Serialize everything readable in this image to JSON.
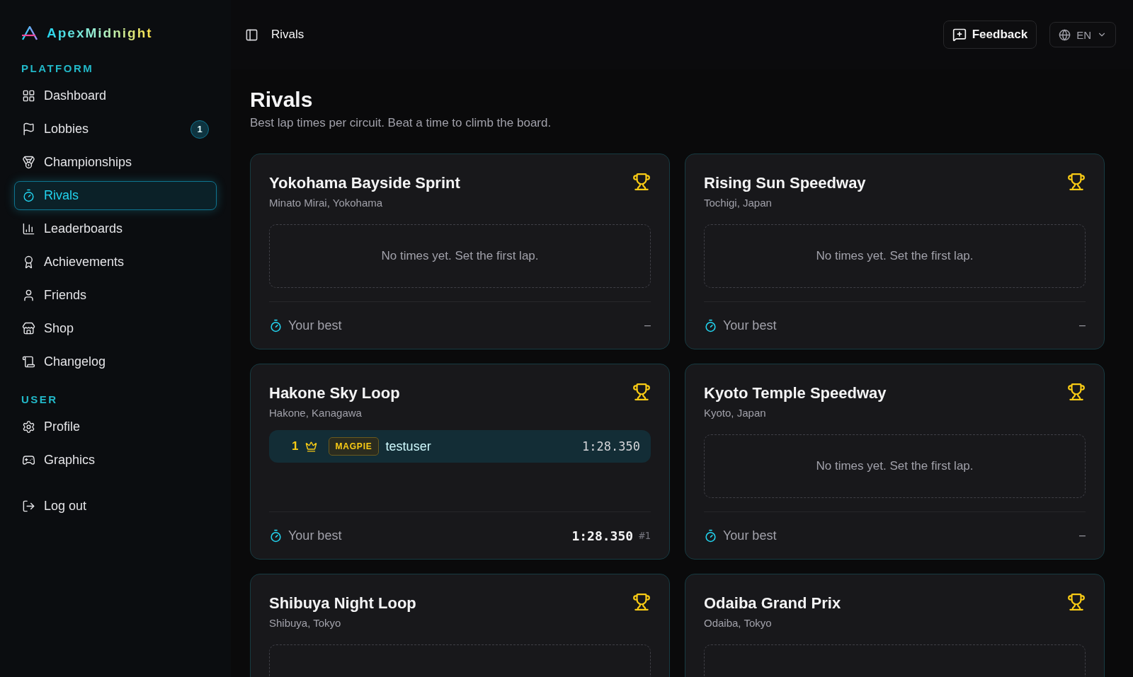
{
  "brand": "ApexMidnight",
  "sidebar": {
    "sections": [
      {
        "title": "PLATFORM",
        "items": [
          {
            "label": "Dashboard",
            "selected": false
          },
          {
            "label": "Lobbies",
            "selected": false,
            "badge": "1"
          },
          {
            "label": "Championships",
            "selected": false
          },
          {
            "label": "Rivals",
            "selected": true
          },
          {
            "label": "Leaderboards",
            "selected": false
          },
          {
            "label": "Achievements",
            "selected": false
          },
          {
            "label": "Friends",
            "selected": false
          },
          {
            "label": "Shop",
            "selected": false
          },
          {
            "label": "Changelog",
            "selected": false
          }
        ]
      },
      {
        "title": "USER",
        "items": [
          {
            "label": "Profile",
            "selected": false
          },
          {
            "label": "Graphics",
            "selected": false
          }
        ]
      }
    ],
    "logout": "Log out"
  },
  "header": {
    "breadcrumb": "Rivals",
    "feedback": "Feedback",
    "language": "EN"
  },
  "page": {
    "title": "Rivals",
    "subtitle": "Best lap times per circuit. Beat a time to climb the board."
  },
  "circuits": [
    {
      "title": "Yokohama Bayside Sprint",
      "location": "Minato Mirai, Yokohama",
      "empty_text": "No times yet. Set the first lap.",
      "best_label": "Your best",
      "best_time": "–"
    },
    {
      "title": "Rising Sun Speedway",
      "location": "Tochigi, Japan",
      "empty_text": "No times yet. Set the first lap.",
      "best_label": "Your best",
      "best_time": "–"
    },
    {
      "title": "Hakone Sky Loop",
      "location": "Hakone, Kanagawa",
      "entries": [
        {
          "rank": "1",
          "tag": "MAGPIE",
          "name": "testuser",
          "time": "1:28.350",
          "mine": true
        }
      ],
      "best_label": "Your best",
      "best_time": "1:28.350",
      "best_rank": "#1"
    },
    {
      "title": "Kyoto Temple Speedway",
      "location": "Kyoto, Japan",
      "empty_text": "No times yet. Set the first lap.",
      "best_label": "Your best",
      "best_time": "–"
    },
    {
      "title": "Shibuya Night Loop",
      "location": "Shibuya, Tokyo"
    },
    {
      "title": "Odaiba Grand Prix",
      "location": "Odaiba, Tokyo"
    }
  ]
}
